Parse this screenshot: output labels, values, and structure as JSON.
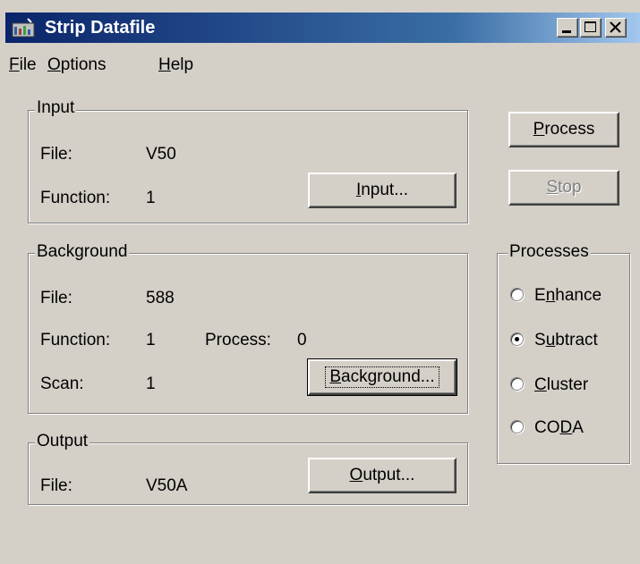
{
  "window": {
    "title": "Strip Datafile",
    "icon": "app-icon"
  },
  "menu": [
    {
      "label": "File",
      "mnemonic": "F",
      "rest": "ile"
    },
    {
      "label": "Options",
      "mnemonic": "O",
      "rest": "ptions"
    },
    {
      "label": "Help",
      "mnemonic": "H",
      "rest": "elp"
    }
  ],
  "input": {
    "legend": "Input",
    "file_label": "File:",
    "file_value": "V50",
    "function_label": "Function:",
    "function_value": "1",
    "button": {
      "pre": "",
      "mnemonic": "I",
      "post": "nput..."
    }
  },
  "background": {
    "legend": "Background",
    "file_label": "File:",
    "file_value": "588",
    "function_label": "Function:",
    "function_value": "1",
    "process_label": "Process:",
    "process_value": "0",
    "scan_label": "Scan:",
    "scan_value": "1",
    "button": {
      "pre": "",
      "mnemonic": "B",
      "post": "ackground..."
    }
  },
  "output": {
    "legend": "Output",
    "file_label": "File:",
    "file_value": "V50A",
    "button": {
      "pre": "",
      "mnemonic": "O",
      "post": "utput..."
    }
  },
  "actions": {
    "process": {
      "pre": "",
      "mnemonic": "P",
      "post": "rocess"
    },
    "stop": {
      "pre": "",
      "mnemonic": "S",
      "post": "top",
      "disabled": true
    }
  },
  "processes": {
    "legend": "Processes",
    "options": [
      {
        "pre": "E",
        "mnemonic": "n",
        "post": "hance",
        "checked": false
      },
      {
        "pre": "S",
        "mnemonic": "u",
        "post": "btract",
        "checked": true
      },
      {
        "pre": "",
        "mnemonic": "C",
        "post": "luster",
        "checked": false
      },
      {
        "pre": "CO",
        "mnemonic": "D",
        "post": "A",
        "checked": false
      }
    ]
  }
}
